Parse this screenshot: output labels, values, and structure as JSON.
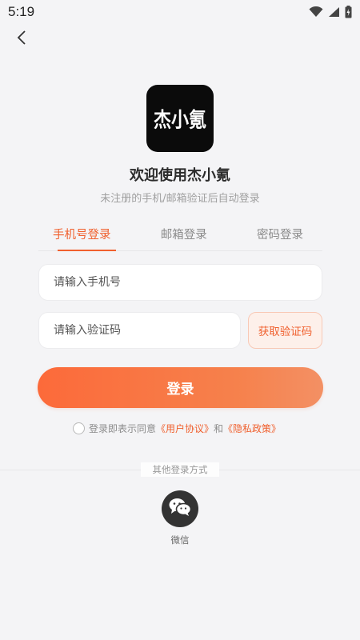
{
  "status_bar": {
    "time": "5:19",
    "icons": [
      "wifi-icon",
      "signal-icon",
      "battery-icon"
    ]
  },
  "nav": {
    "back_icon": "chevron-left-icon"
  },
  "app": {
    "logo_text": "杰小氪",
    "welcome_title": "欢迎使用杰小氪",
    "welcome_subtitle": "未注册的手机/邮箱验证后自动登录"
  },
  "tabs": [
    {
      "label": "手机号登录",
      "active": true
    },
    {
      "label": "邮箱登录",
      "active": false
    },
    {
      "label": "密码登录",
      "active": false
    }
  ],
  "form": {
    "phone_placeholder": "请输入手机号",
    "code_placeholder": "请输入验证码",
    "get_code_label": "获取验证码",
    "login_label": "登录"
  },
  "agreement": {
    "prefix": "登录即表示同意",
    "user_agreement": "《用户协议》",
    "conjunction": "和",
    "privacy_policy": "《隐私政策》",
    "checked": false
  },
  "other_login": {
    "label": "其他登录方式",
    "wechat_label": "微信",
    "wechat_icon": "wechat-icon"
  },
  "colors": {
    "accent": "#f0602e",
    "background": "#f4f4f6",
    "login_gradient_start": "#fc6a3a",
    "login_gradient_end": "#f39064",
    "logo_bg": "#0b0b0b"
  }
}
